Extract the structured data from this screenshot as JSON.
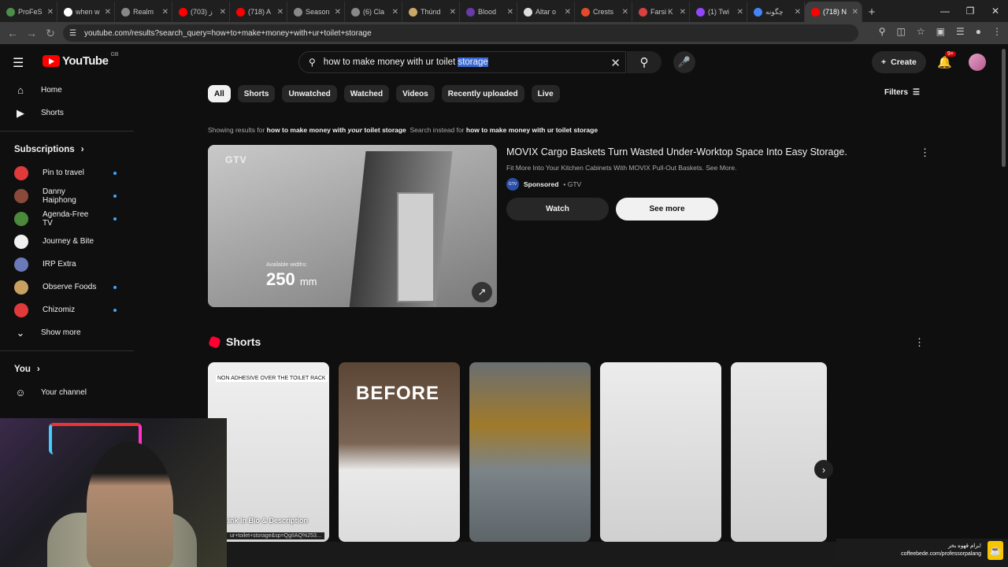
{
  "browser": {
    "tabs": [
      {
        "title": "ProFeS",
        "color": "#4a8f4a",
        "active": false
      },
      {
        "title": "when w",
        "color": "#ffffff",
        "active": false
      },
      {
        "title": "Realm",
        "color": "#888888",
        "active": false
      },
      {
        "title": "ز (703)",
        "color": "#ff0000",
        "active": false
      },
      {
        "title": "(718) A",
        "color": "#ff0000",
        "active": false
      },
      {
        "title": "Season",
        "color": "#888888",
        "active": false
      },
      {
        "title": "(6) Cla",
        "color": "#888888",
        "active": false
      },
      {
        "title": "Thúnd",
        "color": "#caa86a",
        "active": false
      },
      {
        "title": "Blood",
        "color": "#6a3aa8",
        "active": false
      },
      {
        "title": "Altar o",
        "color": "#dddddd",
        "active": false
      },
      {
        "title": "Crests",
        "color": "#e34a2c",
        "active": false
      },
      {
        "title": "Farsi K",
        "color": "#d94040",
        "active": false
      },
      {
        "title": "(1) Twi",
        "color": "#9146ff",
        "active": false
      },
      {
        "title": "چگونه",
        "color": "#4285f4",
        "active": false
      },
      {
        "title": "(718) N",
        "color": "#ff0000",
        "active": true
      }
    ],
    "url": "youtube.com/results?search_query=how+to+make+money+with+ur+toilet+storage"
  },
  "header": {
    "logo": "YouTube",
    "region": "GB",
    "search_query": "how to make money with ur toilet ",
    "search_query_highlight": "storage",
    "create_label": "Create",
    "notif_badge": "9+"
  },
  "sidebar": {
    "home": "Home",
    "shorts": "Shorts",
    "subscriptions": "Subscriptions",
    "channels": [
      {
        "name": "Pin to travel",
        "color": "#e03a3a",
        "dot": true
      },
      {
        "name": "Danny Haiphong",
        "color": "#8a4a3a",
        "dot": true
      },
      {
        "name": "Agenda-Free TV",
        "color": "#4a8a3a",
        "dot": true
      },
      {
        "name": "Journey & Bite",
        "color": "#f1f1f1",
        "dot": false
      },
      {
        "name": "IRP Extra",
        "color": "#6a7ab8",
        "dot": false
      },
      {
        "name": "Observe Foods",
        "color": "#c8a060",
        "dot": true
      },
      {
        "name": "Chizomiz",
        "color": "#e03a3a",
        "dot": true
      }
    ],
    "show_more": "Show more",
    "you": "You",
    "your_channel": "Your channel"
  },
  "chips": [
    "All",
    "Shorts",
    "Unwatched",
    "Watched",
    "Videos",
    "Recently uploaded",
    "Live"
  ],
  "filters": "Filters",
  "showing": {
    "prefix": "Showing results for ",
    "q1": "how to make money with ",
    "q1_italic": "your",
    "q1_end": " toilet storage",
    "mid": "Search instead for ",
    "q2": "how to make money with ur toilet storage"
  },
  "ad": {
    "thumb_brand": "GTV",
    "thumb_small": "Available widths:",
    "thumb_big": "250",
    "thumb_unit": "mm",
    "title": "MOVIX Cargo Baskets Turn Wasted Under-Worktop Space Into Easy Storage.",
    "desc": "Fit More Into Your Kitchen Cabinets With MOVIX Pull-Out Baskets. See More.",
    "channel_icon": "GTV",
    "sponsored": "Sponsored",
    "channel": " • GTV",
    "watch": "Watch",
    "see_more": "See more"
  },
  "shorts": {
    "heading": "Shorts",
    "items": [
      {
        "caption": "NON ADHESIVE OVER THE TOILET RACK",
        "overlay": "",
        "bottom": "Link In Bio & Description"
      },
      {
        "caption": "",
        "overlay": "BEFORE",
        "bottom": ""
      },
      {
        "caption": "",
        "overlay": "",
        "bottom": ""
      },
      {
        "caption": "",
        "overlay": "",
        "bottom": ""
      },
      {
        "caption": "",
        "overlay": "",
        "bottom": ""
      }
    ]
  },
  "status_url": "ur+toilet+storage&sp=QgIIAQ%253...",
  "coffee": {
    "line1": "برام قهوه بخر!",
    "line2": "coffeebede.com/professorpalang"
  }
}
